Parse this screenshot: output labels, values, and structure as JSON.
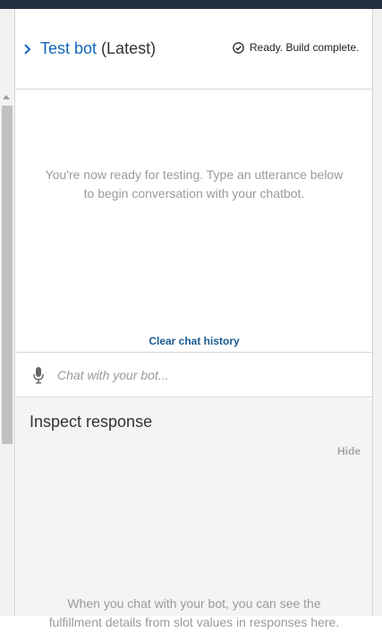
{
  "header": {
    "title_link": "Test bot",
    "title_suffix": " (Latest)",
    "status_text": "Ready. Build complete."
  },
  "chat": {
    "empty_line1": "You're now ready for testing. Type an utterance below",
    "empty_line2": "to begin conversation with your chatbot.",
    "clear_history_label": "Clear chat history",
    "input_placeholder": "Chat with your bot..."
  },
  "inspect": {
    "title": "Inspect response",
    "hide_label": "Hide",
    "hint_line1": "When you chat with your bot, you can see the",
    "hint_line2": "fulfillment details from slot values in responses here."
  },
  "colors": {
    "topbar": "#232f3e",
    "link": "#1166bb",
    "clear_history": "#1b5a8f",
    "muted_text": "#9a9a9a"
  },
  "icons": {
    "expand": "chevron-right-icon",
    "status": "check-circle-icon",
    "mic": "microphone-icon"
  }
}
